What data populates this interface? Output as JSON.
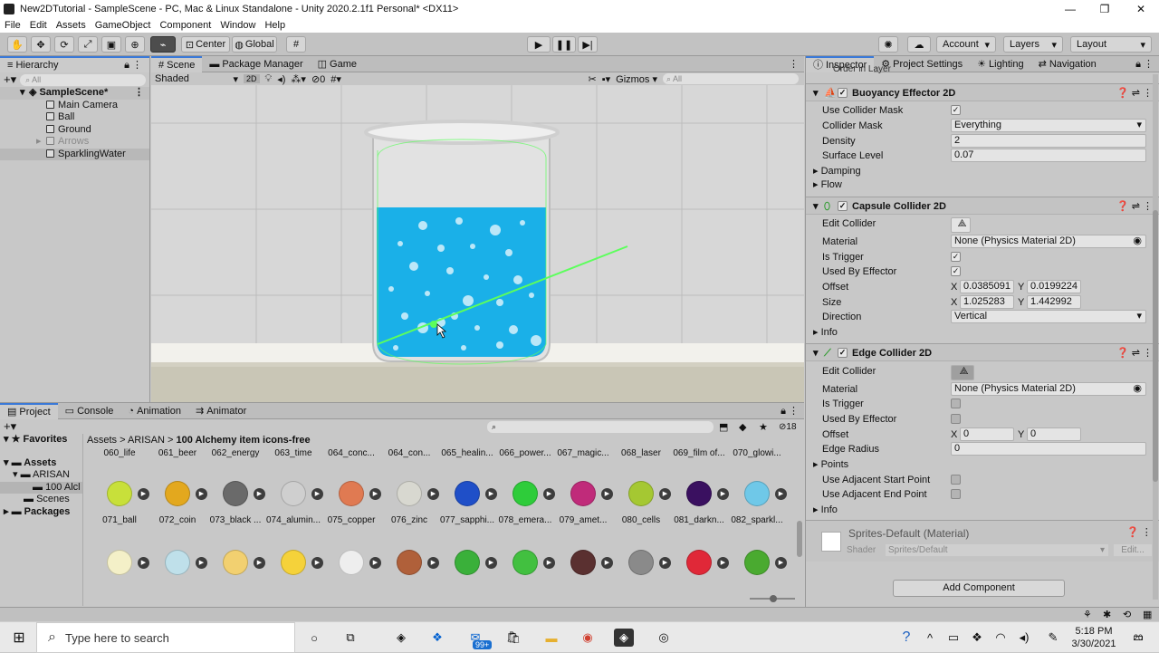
{
  "window": {
    "title": "New2DTutorial - SampleScene - PC, Mac & Linux Standalone - Unity 2020.2.1f1 Personal* <DX11>"
  },
  "menu": [
    "File",
    "Edit",
    "Assets",
    "GameObject",
    "Component",
    "Window",
    "Help"
  ],
  "toolbar": {
    "center": "Center",
    "global": "Global",
    "account": "Account",
    "layers": "Layers",
    "layout": "Layout"
  },
  "hierarchy": {
    "tab": "Hierarchy",
    "search_placeholder": "All",
    "scene": "SampleScene*",
    "items": [
      "Main Camera",
      "Ball",
      "Ground",
      "Arrows",
      "SparklingWater"
    ]
  },
  "scene": {
    "tabs": [
      "Scene",
      "Package Manager",
      "Game"
    ],
    "shading": "Shaded",
    "mode_2d": "2D",
    "hidden_count": "0",
    "gizmos": "Gizmos",
    "search_placeholder": "All"
  },
  "project": {
    "tabs": [
      "Project",
      "Console",
      "Animation",
      "Animator"
    ],
    "breadcrumb": [
      "Assets",
      "ARISAN",
      "100 Alchemy item icons-free"
    ],
    "hidden_count": "18",
    "tree": {
      "favorites": "Favorites",
      "assets": "Assets",
      "arisan": "ARISAN",
      "alchemy": "100 Alcl",
      "scenes": "Scenes",
      "packages": "Packages"
    },
    "top_labels": [
      "060_life",
      "061_beer",
      "062_energy",
      "063_time",
      "064_conc...",
      "064_con...",
      "065_healin...",
      "066_power...",
      "067_magic...",
      "068_laser",
      "069_film of...",
      "070_glowi..."
    ],
    "row1": [
      "071_ball",
      "072_coin",
      "073_black ...",
      "074_alumin...",
      "075_copper",
      "076_zinc",
      "077_sapphi...",
      "078_emera...",
      "079_amet...",
      "080_cells",
      "081_darkn...",
      "082_sparkl..."
    ],
    "row1_colors": [
      "#c8e03a",
      "#e3a81e",
      "#6a6a6a",
      "#cfcfcf",
      "#e07a52",
      "#d8d8d0",
      "#1f4fc8",
      "#2ecc3a",
      "#c02b7a",
      "#a5c832",
      "#3a1060",
      "#6fc8e8"
    ],
    "row2_colors": [
      "#f4f0c8",
      "#bfe0ea",
      "#f2d070",
      "#f5d23a",
      "#eeeeee",
      "#b0603a",
      "#3ab03a",
      "#42c040",
      "#5a3030",
      "#8a8a8a",
      "#e02838",
      "#4aaa30"
    ]
  },
  "inspector": {
    "tabs": [
      "Inspector",
      "Project Settings",
      "Lighting",
      "Navigation"
    ],
    "order_label": "Order in Layer",
    "buoyancy": {
      "title": "Buoyancy Effector 2D",
      "rows": [
        {
          "label": "Use Collider Mask",
          "value": "✓"
        },
        {
          "label": "Collider Mask",
          "value": "Everything"
        },
        {
          "label": "Density",
          "value": "2"
        },
        {
          "label": "Surface Level",
          "value": "0.07"
        }
      ],
      "foldouts": [
        "Damping",
        "Flow"
      ]
    },
    "capsule": {
      "title": "Capsule Collider 2D",
      "edit": "Edit Collider",
      "material_label": "Material",
      "material": "None (Physics Material 2D)",
      "is_trigger": "Is Trigger",
      "used_by_effector": "Used By Effector",
      "offset_label": "Offset",
      "offset_x": "0.0385091",
      "offset_y": "0.0199224",
      "size_label": "Size",
      "size_x": "1.025283",
      "size_y": "1.442992",
      "direction_label": "Direction",
      "direction": "Vertical",
      "info": "Info"
    },
    "edge": {
      "title": "Edge Collider 2D",
      "edit": "Edit Collider",
      "material_label": "Material",
      "material": "None (Physics Material 2D)",
      "is_trigger": "Is Trigger",
      "used_by_effector": "Used By Effector",
      "offset_label": "Offset",
      "offset_x": "0",
      "offset_y": "0",
      "radius_label": "Edge Radius",
      "radius": "0",
      "points": "Points",
      "adj_start": "Use Adjacent Start Point",
      "adj_end": "Use Adjacent End Point",
      "info": "Info"
    },
    "material": {
      "name": "Sprites-Default (Material)",
      "shader_label": "Shader",
      "shader": "Sprites/Default",
      "edit": "Edit..."
    },
    "add_component": "Add Component"
  },
  "taskbar": {
    "search_placeholder": "Type here to search",
    "badge": "99+",
    "time": "5:18 PM",
    "date": "3/30/2021",
    "notif": "20"
  },
  "colors": {
    "water": "#1ab0e8",
    "collider": "#5cff5c",
    "accent": "#3a79d8"
  }
}
